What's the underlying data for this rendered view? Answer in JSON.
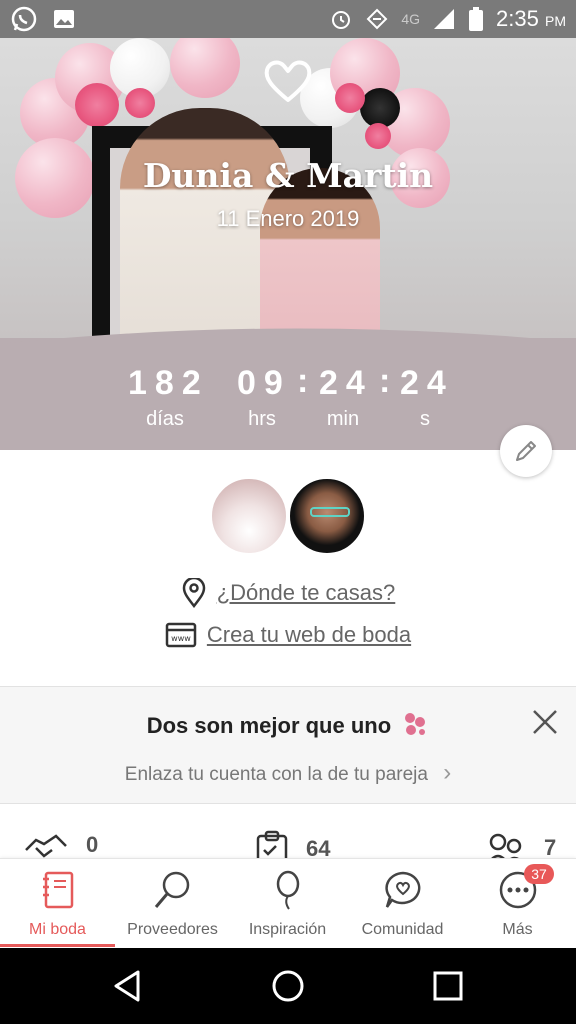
{
  "status_bar": {
    "network": "4G",
    "time": "2:35",
    "ampm": "PM"
  },
  "hero": {
    "couple_name": "Dunia & Martin",
    "date": "11 Enero 2019"
  },
  "countdown": {
    "days": "182",
    "hours": "09",
    "minutes": "24",
    "seconds": "24",
    "separator": ":",
    "days_label": "días",
    "hours_label": "hrs",
    "minutes_label": "min",
    "seconds_label": "s"
  },
  "links": {
    "where": "¿Dónde te casas?",
    "web": "Crea tu web de boda"
  },
  "promo": {
    "title": "Dos son mejor que uno",
    "subtitle": "Enlaza tu cuenta con la de tu pareja",
    "chevron": "›"
  },
  "stats": [
    {
      "icon": "handshake-icon",
      "value": "0"
    },
    {
      "icon": "clipboard-icon",
      "value": "64"
    },
    {
      "icon": "guests-icon",
      "value": "7"
    }
  ],
  "nav": [
    {
      "label": "Mi boda",
      "icon": "notebook-icon",
      "active": true
    },
    {
      "label": "Proveedores",
      "icon": "magnifier-icon"
    },
    {
      "label": "Inspiración",
      "icon": "balloon-icon"
    },
    {
      "label": "Comunidad",
      "icon": "chat-heart-icon"
    },
    {
      "label": "Más",
      "icon": "more-icon",
      "badge": "37"
    }
  ],
  "colors": {
    "accent": "#e55a5a",
    "countdown_band": "#b9adb1",
    "badge": "#e85858"
  }
}
